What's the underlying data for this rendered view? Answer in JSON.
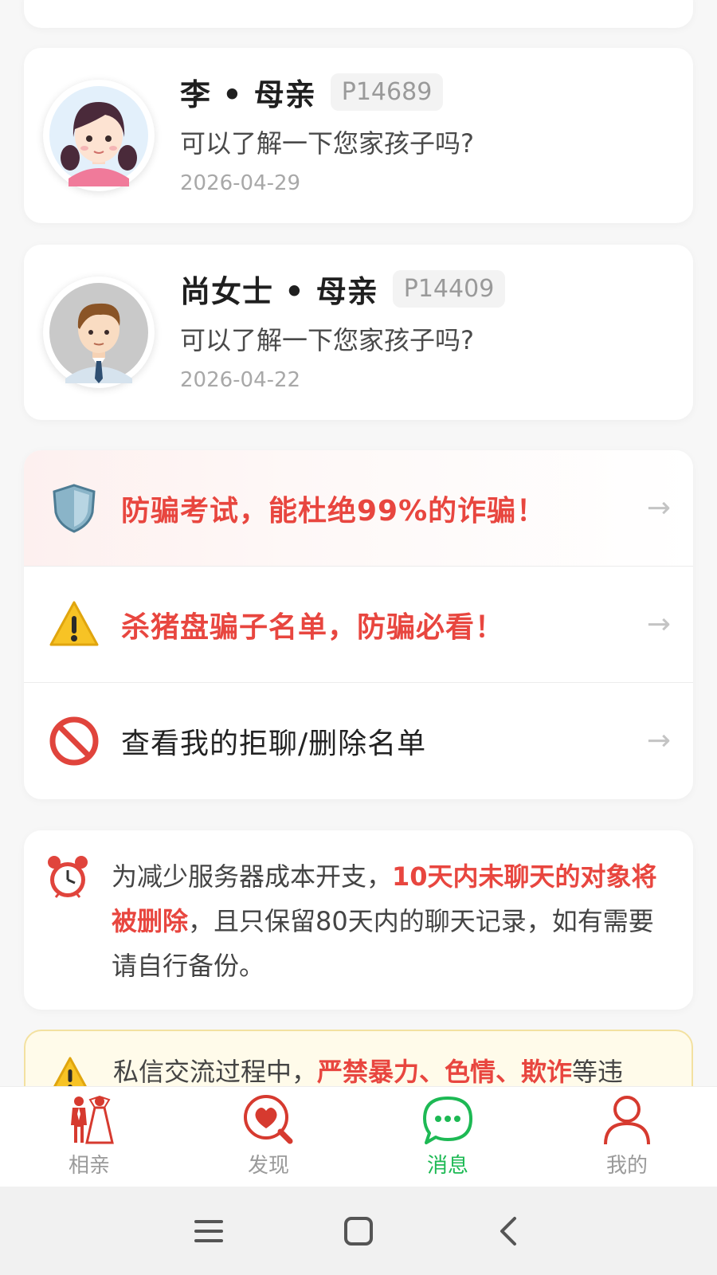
{
  "messages": [
    {
      "name": "李 • 母亲",
      "pid": "P14689",
      "preview": "可以了解一下您家孩子吗?",
      "date": "2026-04-29",
      "avatar": "girl-avatar-icon"
    },
    {
      "name": "尚女士 • 母亲",
      "pid": "P14409",
      "preview": "可以了解一下您家孩子吗?",
      "date": "2026-04-22",
      "avatar": "man-avatar-icon"
    }
  ],
  "links": [
    {
      "text": "防骗考试，能杜绝99%的诈骗！",
      "icon": "shield-icon",
      "arrow": "→"
    },
    {
      "text": "杀猪盘骗子名单，防骗必看！",
      "icon": "warning-icon",
      "arrow": "→"
    },
    {
      "text": "查看我的拒聊/删除名单",
      "icon": "prohibited-icon",
      "arrow": "→"
    }
  ],
  "notice": {
    "icon": "alarm-clock-icon",
    "part1": "为减少服务器成本开支，",
    "highlight": "10天内未聊天的对象将被删除",
    "part2": "，且只保留80天内的聊天记录，如有需要请自行备份。"
  },
  "warning": {
    "icon": "warning-icon",
    "part1": "私信交流过程中，",
    "highlight": "严禁暴力、色情、欺诈",
    "part2": "等违"
  },
  "nav": [
    {
      "label": "相亲",
      "icon": "couple-icon"
    },
    {
      "label": "发现",
      "icon": "discover-heart-icon"
    },
    {
      "label": "消息",
      "icon": "chat-bubble-icon",
      "active": true
    },
    {
      "label": "我的",
      "icon": "person-icon"
    }
  ],
  "colors": {
    "accent_red": "#e8463f",
    "active_green": "#1db954",
    "nav_red": "#d63a2f"
  }
}
